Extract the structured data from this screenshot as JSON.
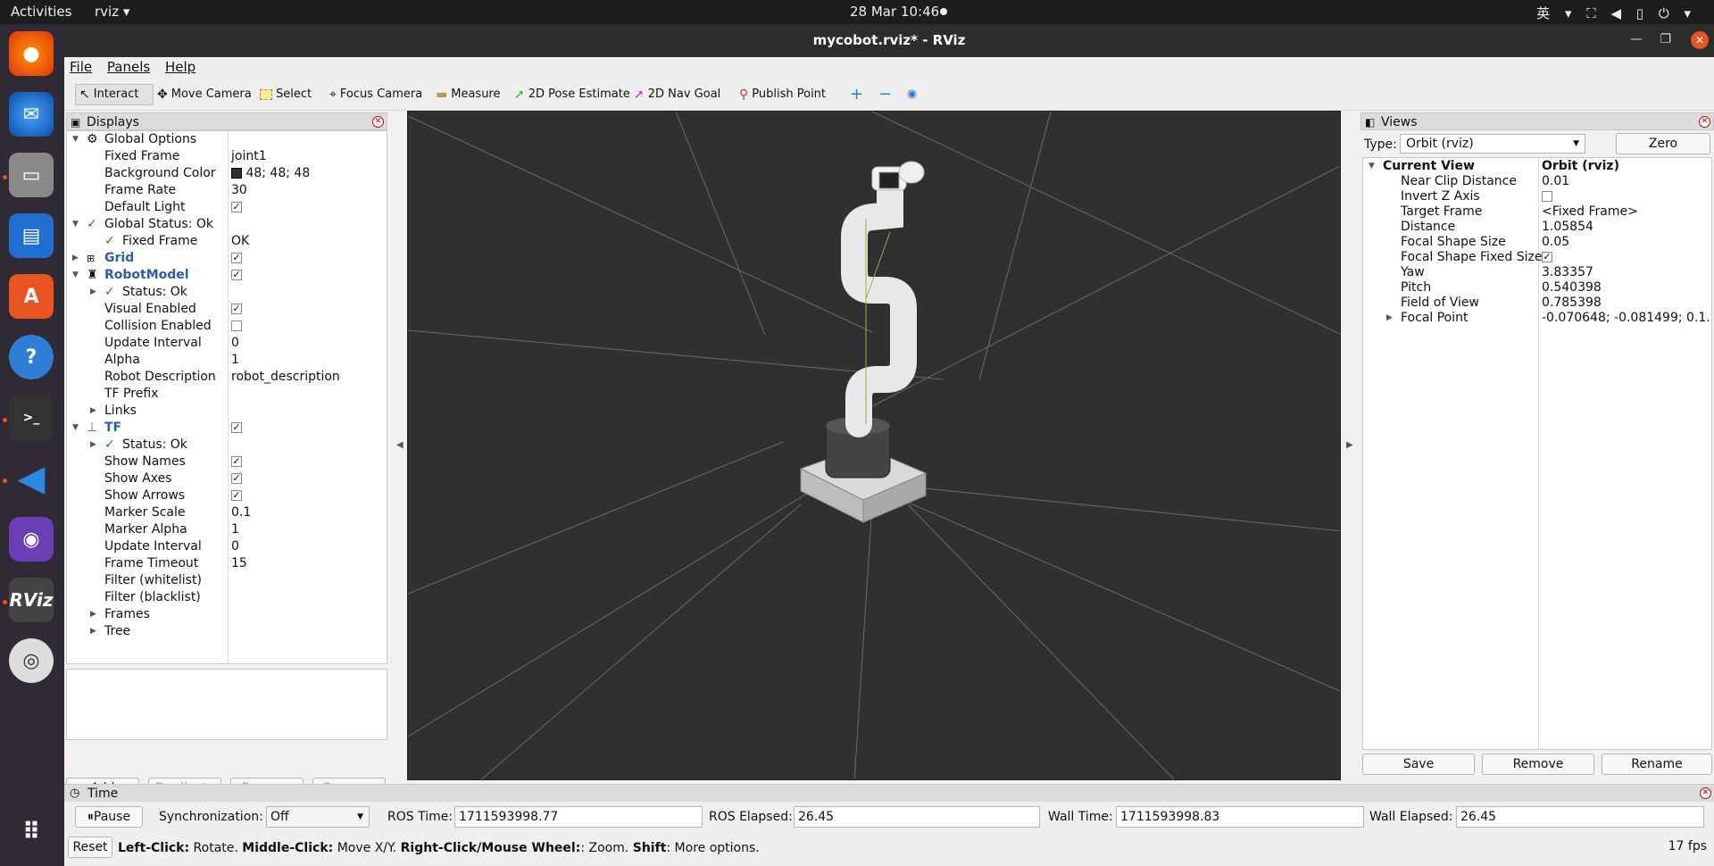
{
  "topbar": {
    "activities": "Activities",
    "app": "rviz ▾",
    "clock": "28 Mar  10:46",
    "tray": "英 ▾  ⛶ ◀ ▯ ⏻ ▾"
  },
  "window": {
    "title": "mycobot.rviz* - RViz"
  },
  "menu": {
    "file": "File",
    "panels": "Panels",
    "help": "Help"
  },
  "toolbar": {
    "interact": "Interact",
    "move_camera": "Move Camera",
    "select": "Select",
    "focus_camera": "Focus Camera",
    "measure": "Measure",
    "pose_estimate": "2D Pose Estimate",
    "nav_goal": "2D Nav Goal",
    "publish_point": "Publish Point"
  },
  "displays": {
    "title": "Displays",
    "rows": [
      {
        "key": "Global Options",
        "val": ""
      },
      {
        "key": "Fixed Frame",
        "val": "joint1"
      },
      {
        "key": "Background Color",
        "val": "48; 48; 48"
      },
      {
        "key": "Frame Rate",
        "val": "30"
      },
      {
        "key": "Default Light",
        "val": ""
      },
      {
        "key": "Global Status: Ok",
        "val": ""
      },
      {
        "key": "Fixed Frame",
        "val": "OK"
      },
      {
        "key": "Grid",
        "val": ""
      },
      {
        "key": "RobotModel",
        "val": ""
      },
      {
        "key": "Status: Ok",
        "val": ""
      },
      {
        "key": "Visual Enabled",
        "val": ""
      },
      {
        "key": "Collision Enabled",
        "val": ""
      },
      {
        "key": "Update Interval",
        "val": "0"
      },
      {
        "key": "Alpha",
        "val": "1"
      },
      {
        "key": "Robot Description",
        "val": "robot_description"
      },
      {
        "key": "TF Prefix",
        "val": ""
      },
      {
        "key": "Links",
        "val": ""
      },
      {
        "key": "TF",
        "val": ""
      },
      {
        "key": "Status: Ok",
        "val": ""
      },
      {
        "key": "Show Names",
        "val": ""
      },
      {
        "key": "Show Axes",
        "val": ""
      },
      {
        "key": "Show Arrows",
        "val": ""
      },
      {
        "key": "Marker Scale",
        "val": "0.1"
      },
      {
        "key": "Marker Alpha",
        "val": "1"
      },
      {
        "key": "Update Interval",
        "val": "0"
      },
      {
        "key": "Frame Timeout",
        "val": "15"
      },
      {
        "key": "Filter (whitelist)",
        "val": ""
      },
      {
        "key": "Filter (blacklist)",
        "val": ""
      },
      {
        "key": "Frames",
        "val": ""
      },
      {
        "key": "Tree",
        "val": ""
      }
    ],
    "buttons": {
      "add": "Add",
      "duplicate": "Duplicate",
      "remove": "Remove",
      "rename": "Rename"
    }
  },
  "views": {
    "title": "Views",
    "type_label": "Type:",
    "type_value": "Orbit (rviz)",
    "zero": "Zero",
    "rows": [
      {
        "key": "Current View",
        "val": "Orbit (rviz)"
      },
      {
        "key": "Near Clip Distance",
        "val": "0.01"
      },
      {
        "key": "Invert Z Axis",
        "val": ""
      },
      {
        "key": "Target Frame",
        "val": "<Fixed Frame>"
      },
      {
        "key": "Distance",
        "val": "1.05854"
      },
      {
        "key": "Focal Shape Size",
        "val": "0.05"
      },
      {
        "key": "Focal Shape Fixed Size",
        "val": ""
      },
      {
        "key": "Yaw",
        "val": "3.83357"
      },
      {
        "key": "Pitch",
        "val": "0.540398"
      },
      {
        "key": "Field of View",
        "val": "0.785398"
      },
      {
        "key": "Focal Point",
        "val": "-0.070648; -0.081499; 0.1..."
      }
    ],
    "buttons": {
      "save": "Save",
      "remove": "Remove",
      "rename": "Rename"
    }
  },
  "time": {
    "title": "Time",
    "pause": "Pause",
    "sync_label": "Synchronization:",
    "sync_value": "Off",
    "ros_time_label": "ROS Time:",
    "ros_time": "1711593998.77",
    "ros_elapsed_label": "ROS Elapsed:",
    "ros_elapsed": "26.45",
    "wall_time_label": "Wall Time:",
    "wall_time": "1711593998.83",
    "wall_elapsed_label": "Wall Elapsed:",
    "wall_elapsed": "26.45"
  },
  "status": {
    "reset": "Reset",
    "lc": "Left-Click:",
    "lc_t": " Rotate. ",
    "mc": "Middle-Click:",
    "mc_t": " Move X/Y. ",
    "rc": "Right-Click/Mouse Wheel:",
    "rc_t": ": Zoom. ",
    "sh": "Shift",
    "sh_t": ": More options.",
    "fps": "17 fps"
  },
  "colors": {
    "bg": "#303030",
    "accent": "#e95420"
  }
}
